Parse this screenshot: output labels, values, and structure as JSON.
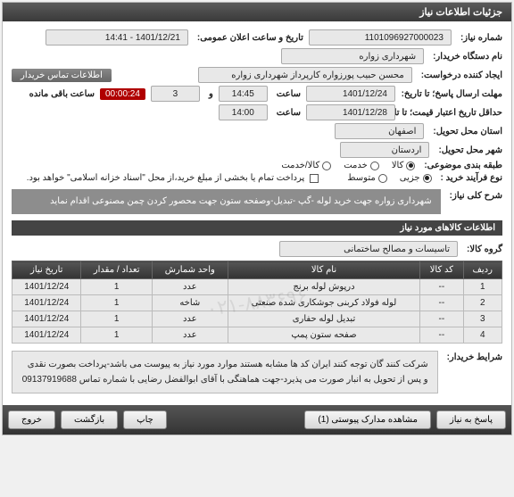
{
  "header": {
    "title": "جزئیات اطلاعات نیاز"
  },
  "info": {
    "need_no_lbl": "شماره نیاز:",
    "need_no": "1101096927000023",
    "pub_dt_lbl": "تاریخ و ساعت اعلان عمومی:",
    "pub_dt": "1401/12/21 - 14:41",
    "org_lbl": "نام دستگاه خریدار:",
    "org": "شهرداری زواره",
    "requester_lbl": "ایجاد کننده درخواست:",
    "requester": "محسن حبیب پورزواره کارپرداز شهرداری زواره",
    "buyer_contact": "اطلاعات تماس خریدار",
    "deadline_lbl": "حداقل تاریخ اعتبار قیمت؛ تا تاریخ:",
    "reply_deadline_lbl": "مهلت ارسال پاسخ؛ تا تاریخ:",
    "date1": "1401/12/24",
    "saat": "ساعت",
    "time1": "14:45",
    "va": "و",
    "days": "3",
    "remaining_suffix": "ساعت باقی مانده",
    "timer": "00:00:24",
    "date2": "1401/12/28",
    "time2": "14:00",
    "loc_lbl": "استان محل تحویل:",
    "loc": "اصفهان",
    "city_lbl": "شهر محل تحویل:",
    "city": "اردستان",
    "class_lbl": "طبقه بندی موضوعی:",
    "class_opts": {
      "kala": "کالا",
      "khadamat": "خدمت",
      "both": "کالا/خدمت",
      "selected": "kala"
    },
    "proc_lbl": "نوع فرآیند خرید :",
    "proc_opts": {
      "a": "جزیی",
      "b": "متوسط",
      "selected": "a"
    },
    "treasury": "پرداخت تمام یا بخشی از مبلغ خرید،از محل \"اسناد خزانه اسلامی\" خواهد بود.",
    "desc_lbl": "شرح کلی نیاز:",
    "desc": "شهرداری زواره جهت خرید لوله -گپ -تبدیل-وصفحه ستون جهت محصور کردن چمن مصنوعی اقدام نماید",
    "group_lbl": "گروه کالا:",
    "group": "تاسیسات و مصالح ساختمانی",
    "buyer_note_lbl": "شرایط خریدار:",
    "buyer_note": "شرکت کنند گان توجه کنند ایران کد ها مشابه هستند  موارد مورد نیاز به پیوست می باشد-پرداخت بصورت نقدی و پس از تحویل به انبار صورت می پذیرد-جهت هماهنگی با آقای ابوالفضل رضایی با شماره تماس 09137919688"
  },
  "subheader": "اطلاعات کالاهای مورد نیاز",
  "table": {
    "headers": [
      "ردیف",
      "کد کالا",
      "نام کالا",
      "واحد شمارش",
      "تعداد / مقدار",
      "تاریخ نیاز"
    ],
    "rows": [
      [
        "1",
        "--",
        "درپوش لوله برنج",
        "عدد",
        "1",
        "1401/12/24"
      ],
      [
        "2",
        "--",
        "لوله فولاد کربنی جوشکاری شده صنعتی",
        "شاخه",
        "1",
        "1401/12/24"
      ],
      [
        "3",
        "--",
        "تبدیل لوله حفاری",
        "عدد",
        "1",
        "1401/12/24"
      ],
      [
        "4",
        "--",
        "صفحه ستون پمپ",
        "عدد",
        "1",
        "1401/12/24"
      ]
    ],
    "watermark": "۰۲۱-۸۸۳۶۹۶"
  },
  "buttons": {
    "respond": "پاسخ به نیاز",
    "attachments": "مشاهده مدارک پیوستی (1)",
    "print": "چاپ",
    "back": "بازگشت",
    "exit": "خروج"
  }
}
